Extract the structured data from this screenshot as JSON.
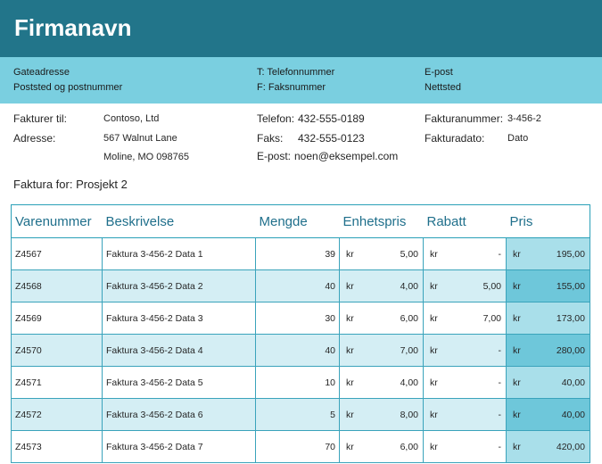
{
  "company": {
    "name": "Firmanavn"
  },
  "contact": {
    "street": "Gateadresse",
    "postal": "Poststed og postnummer",
    "phone": "T: Telefonnummer",
    "fax": "F: Faksnummer",
    "email": "E-post",
    "website": "Nettsted"
  },
  "billing": {
    "billed_to_label": "Fakturer til:",
    "billed_to_value": "Contoso, Ltd",
    "address_label": "Adresse:",
    "address_line1": "567 Walnut Lane",
    "address_line2": "Moline, MO 098765",
    "phone_label": "Telefon:",
    "phone_value": "432-555-0189",
    "fax_label": "Faks:",
    "fax_value": "432-555-0123",
    "email_label": "E-post:",
    "email_value": "noen@eksempel.com",
    "invoice_no_label": "Fakturanummer:",
    "invoice_no_value": "3-456-2",
    "invoice_date_label": "Fakturadato:",
    "invoice_date_value": "Dato"
  },
  "project_line": "Faktura for: Prosjekt 2",
  "table": {
    "headers": [
      "Varenummer",
      "Beskrivelse",
      "Mengde",
      "Enhetspris",
      "Rabatt",
      "Pris"
    ],
    "rows": [
      {
        "item": "Z4567",
        "desc": "Faktura 3-456-2 Data 1",
        "qty": "39",
        "cur": "kr",
        "unit": "5,00",
        "disc": "-",
        "price": "195,00"
      },
      {
        "item": "Z4568",
        "desc": "Faktura 3-456-2 Data 2",
        "qty": "40",
        "cur": "kr",
        "unit": "4,00",
        "disc": "5,00",
        "price": "155,00"
      },
      {
        "item": "Z4569",
        "desc": "Faktura 3-456-2 Data 3",
        "qty": "30",
        "cur": "kr",
        "unit": "6,00",
        "disc": "7,00",
        "price": "173,00"
      },
      {
        "item": "Z4570",
        "desc": "Faktura 3-456-2 Data 4",
        "qty": "40",
        "cur": "kr",
        "unit": "7,00",
        "disc": "-",
        "price": "280,00"
      },
      {
        "item": "Z4571",
        "desc": "Faktura 3-456-2 Data 5",
        "qty": "10",
        "cur": "kr",
        "unit": "4,00",
        "disc": "-",
        "price": "40,00"
      },
      {
        "item": "Z4572",
        "desc": "Faktura 3-456-2 Data 6",
        "qty": "5",
        "cur": "kr",
        "unit": "8,00",
        "disc": "-",
        "price": "40,00"
      },
      {
        "item": "Z4573",
        "desc": "Faktura 3-456-2 Data 7",
        "qty": "70",
        "cur": "kr",
        "unit": "6,00",
        "disc": "-",
        "price": "420,00"
      }
    ]
  },
  "colors": {
    "header": "#22758a",
    "band": "#7acfe0",
    "accent": "#1f6f8b"
  }
}
